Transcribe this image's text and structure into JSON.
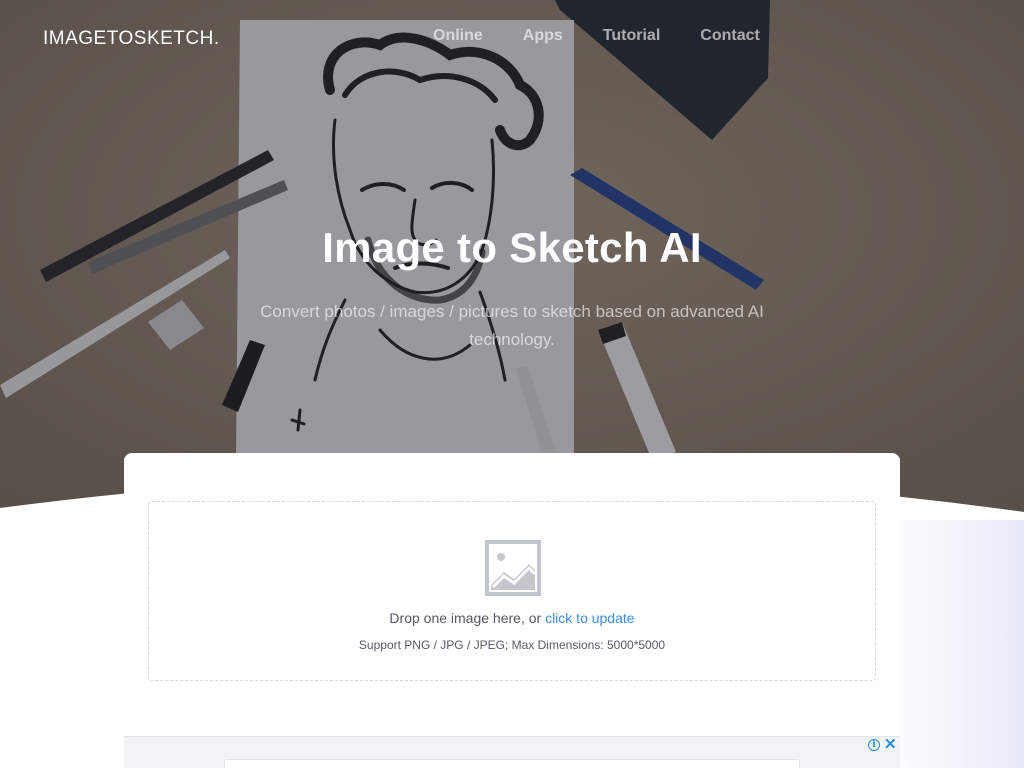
{
  "brand": {
    "logo_text": "IMAGETOSKETCH."
  },
  "nav": {
    "items": [
      {
        "label": "Online"
      },
      {
        "label": "Apps"
      },
      {
        "label": "Tutorial"
      },
      {
        "label": "Contact"
      }
    ]
  },
  "hero": {
    "title": "Image to Sketch AI",
    "subtitle": "Convert photos / images / pictures to sketch based on advanced AI technology."
  },
  "upload": {
    "icon": "image-placeholder-icon",
    "prompt": "Drop one image here, or ",
    "link_label": "click to update",
    "support_text": "Support PNG / JPG / JPEG; Max Dimensions: 5000*5000"
  },
  "ad": {
    "info_glyph": "i",
    "close_glyph": "✕"
  },
  "colors": {
    "link": "#3b8ee5",
    "ad_controls": "#2a8de0",
    "dropzone_border": "#d4d7dc",
    "text_muted": "#555a63"
  }
}
